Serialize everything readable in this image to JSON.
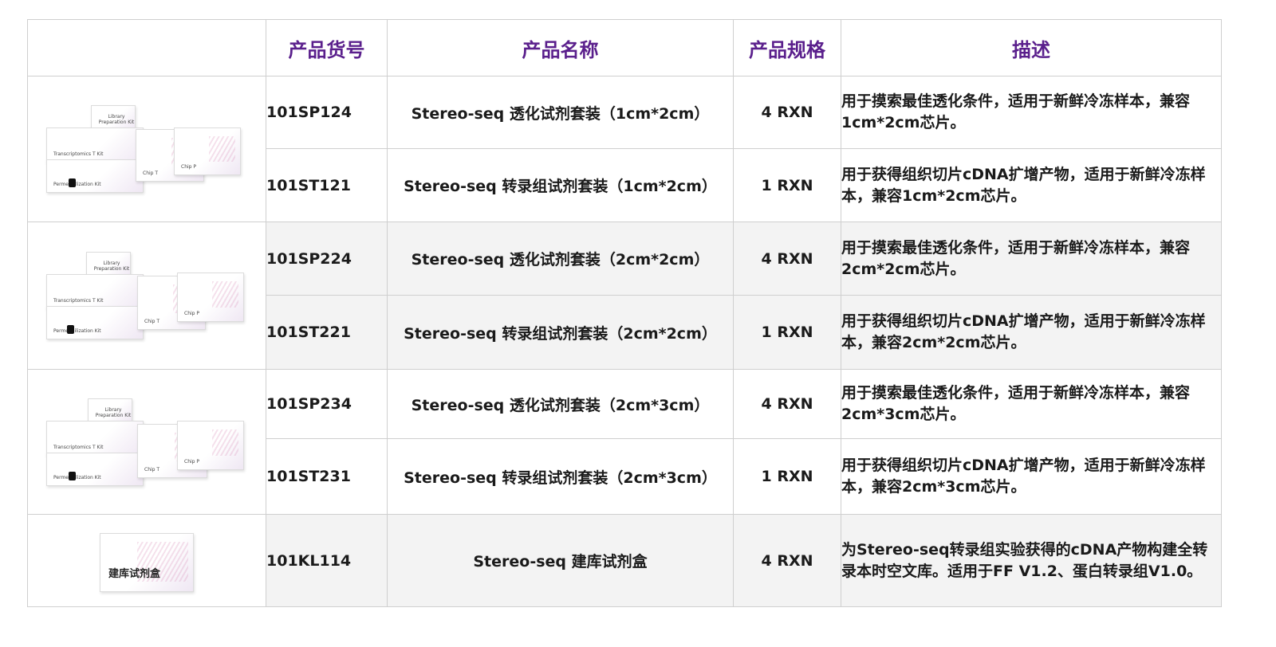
{
  "headers": {
    "image": "",
    "code": "产品货号",
    "name": "产品名称",
    "spec": "产品规格",
    "desc": "描述"
  },
  "rows": [
    {
      "code": "101SP124",
      "name": "Stereo-seq 透化试剂套装（1cm*2cm）",
      "spec": "4 RXN",
      "desc": "用于摸索最佳透化条件，适用于新鲜冷冻样本，兼容1cm*2cm芯片。"
    },
    {
      "code": "101ST121",
      "name": "Stereo-seq 转录组试剂套装（1cm*2cm）",
      "spec": "1 RXN",
      "desc": "用于获得组织切片cDNA扩增产物，适用于新鲜冷冻样本，兼容1cm*2cm芯片。"
    },
    {
      "code": "101SP224",
      "name": "Stereo-seq 透化试剂套装（2cm*2cm）",
      "spec": "4 RXN",
      "desc": "用于摸索最佳透化条件，适用于新鲜冷冻样本，兼容2cm*2cm芯片。"
    },
    {
      "code": "101ST221",
      "name": "Stereo-seq 转录组试剂套装（2cm*2cm）",
      "spec": "1 RXN",
      "desc": "用于获得组织切片cDNA扩增产物，适用于新鲜冷冻样本，兼容2cm*2cm芯片。"
    },
    {
      "code": "101SP234",
      "name": "Stereo-seq 透化试剂套装（2cm*3cm）",
      "spec": "4 RXN",
      "desc": "用于摸索最佳透化条件，适用于新鲜冷冻样本，兼容2cm*3cm芯片。"
    },
    {
      "code": "101ST231",
      "name": "Stereo-seq 转录组试剂套装（2cm*3cm）",
      "spec": "1 RXN",
      "desc": "用于获得组织切片cDNA扩增产物，适用于新鲜冷冻样本，兼容2cm*3cm芯片。"
    },
    {
      "code": "101KL114",
      "name": "Stereo-seq 建库试剂盒",
      "spec": "4 RXN",
      "desc": "为Stereo-seq转录组实验获得的cDNA产物构建全转录本时空文库。适用于FF V1.2、蛋白转录组V1.0。"
    }
  ],
  "kit_labels": {
    "library": "Library Preparation Kit",
    "transcriptomics": "Transcriptomics T Kit",
    "permeabilization": "Permeabilization Kit",
    "chip_t": "Chip T",
    "chip_p": "Chip P",
    "library_box": "建库试剂盒"
  }
}
